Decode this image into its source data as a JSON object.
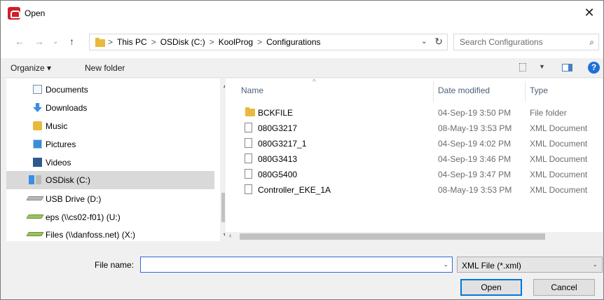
{
  "window": {
    "title": "Open",
    "close_icon": "close-icon"
  },
  "address_bar": {
    "crumbs": [
      "This PC",
      "OSDisk (C:)",
      "KoolProg",
      "Configurations"
    ],
    "separator": ">",
    "search_placeholder": "Search Configurations"
  },
  "toolbar": {
    "organize_label": "Organize ▾",
    "new_folder_label": "New folder"
  },
  "nav_pane": {
    "items": [
      {
        "label": "Documents",
        "icon": "documents-icon"
      },
      {
        "label": "Downloads",
        "icon": "downloads-icon"
      },
      {
        "label": "Music",
        "icon": "music-icon"
      },
      {
        "label": "Pictures",
        "icon": "pictures-icon"
      },
      {
        "label": "Videos",
        "icon": "videos-icon"
      },
      {
        "label": "OSDisk (C:)",
        "icon": "osdisk-icon",
        "selected": true
      },
      {
        "label": "USB Drive (D:)",
        "icon": "usb-drive-icon"
      },
      {
        "label": "eps (\\\\cs02-f01) (U:)",
        "icon": "network-drive-icon"
      },
      {
        "label": "Files (\\\\danfoss.net) (X:)",
        "icon": "network-drive-icon"
      }
    ]
  },
  "file_list": {
    "columns": {
      "name": "Name",
      "date": "Date modified",
      "type": "Type"
    },
    "rows": [
      {
        "name": "BCKFILE",
        "date": "04-Sep-19 3:50 PM",
        "type": "File folder",
        "kind": "folder"
      },
      {
        "name": "080G3217",
        "date": "08-May-19 3:53 PM",
        "type": "XML Document",
        "kind": "file"
      },
      {
        "name": "080G3217_1",
        "date": "04-Sep-19 4:02 PM",
        "type": "XML Document",
        "kind": "file"
      },
      {
        "name": "080G3413",
        "date": "04-Sep-19 3:46 PM",
        "type": "XML Document",
        "kind": "file"
      },
      {
        "name": "080G5400",
        "date": "04-Sep-19 3:47 PM",
        "type": "XML Document",
        "kind": "file"
      },
      {
        "name": "Controller_EKE_1A",
        "date": "08-May-19 3:53 PM",
        "type": "XML Document",
        "kind": "file"
      }
    ]
  },
  "bottom": {
    "file_name_label": "File name:",
    "file_name_value": "",
    "filter_value": "XML File (*.xml)",
    "open_label": "Open",
    "cancel_label": "Cancel"
  },
  "colors": {
    "accent": "#0078d7",
    "selection": "#d9d9d9",
    "help": "#1e6fd8"
  }
}
